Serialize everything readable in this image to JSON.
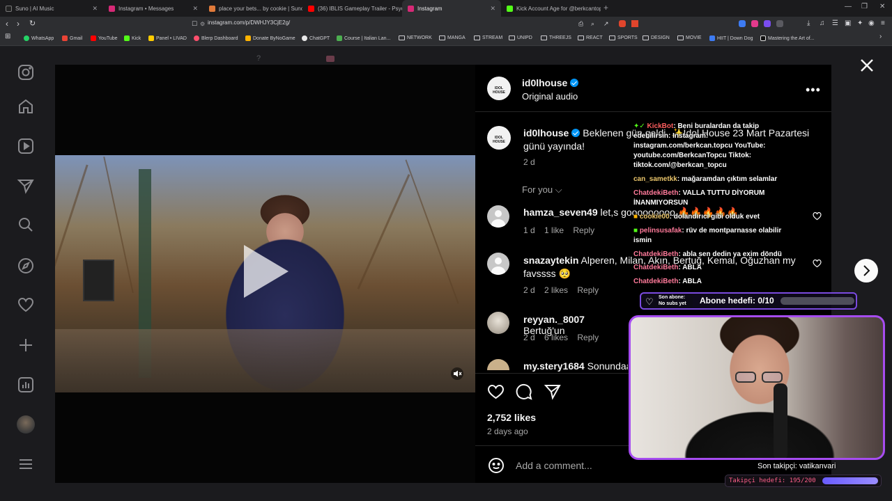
{
  "browser": {
    "tabs": [
      {
        "label": "Suno | AI Music",
        "active": false
      },
      {
        "label": "Instagram • Messages",
        "active": false
      },
      {
        "label": "place your bets... by cookie | Suno",
        "active": false
      },
      {
        "label": "(36) IBLIS Gameplay Trailer - Psychol...",
        "active": false
      },
      {
        "label": "Instagram",
        "active": true
      },
      {
        "label": "Kick Account Age for @berkcantop...",
        "active": false
      }
    ],
    "url": "instagram.com/p/DWHJY3CjE2g/",
    "bookmarks": [
      "WhatsApp",
      "Gmail",
      "YouTube",
      "Kick",
      "Panel • LIVAD",
      "Blerp Dashboard",
      "Donate ByNoGame",
      "ChatGPT",
      "Course | Italian Lan...",
      "NETWORK",
      "MANGA",
      "STREAM",
      "UNIPD",
      "THREEJS",
      "REACT",
      "SPORTS",
      "DESIGN",
      "MOVIE",
      "HIIT | Down Dog",
      "Mastering the Art of..."
    ]
  },
  "post": {
    "author": "id0lhouse",
    "audio": "Original audio",
    "caption_author": "id0lhouse",
    "caption_text": "Beklenen gün geldi. ✨İdol House 23 Mart Pazartesi günü yayında!",
    "caption_age": "2 d",
    "sort_label": "For you",
    "likes": "2,752 likes",
    "posted": "2 days ago",
    "add_comment_placeholder": "Add a comment..."
  },
  "comments": [
    {
      "user": "hamza_seven49",
      "text": "let,s gooooooooo 🔥🔥🔥🔥🔥",
      "age": "1 d",
      "likes": "1 like",
      "reply": "Reply"
    },
    {
      "user": "snazaytekin",
      "text": "Alperen, Milan, Akın, Bertuğ, Kemal, Oğuzhan my favssss 🥺",
      "age": "2 d",
      "likes": "2 likes",
      "reply": "Reply"
    },
    {
      "user": "reyyan._8007",
      "text": "Bertuğ'un",
      "age": "2 d",
      "likes": "6 likes",
      "reply": "Reply"
    },
    {
      "user": "my.stery1684",
      "text": "Sonundaa"
    }
  ],
  "stream_chat": [
    {
      "user": "KickBot",
      "text": "Beni buralardan da takip edebilirsin: Instagram: instagram.com/berkcan.topcu YouTube: youtube.com/BerkcanTopcu Tiktok: tiktok.com/@berkcan_topcu"
    },
    {
      "user": "can_sametkk",
      "text": "mağaramdan çıktım selamlar"
    },
    {
      "user": "ChatdekiBeth",
      "text": "VALLA TUTTU DİYORUM İNANMIYORSUN"
    },
    {
      "user": "cookie00",
      "text": "dolandırıcı gibi olduk evet"
    },
    {
      "user": "pelinsusafak",
      "text": "rüv de montparnasse olabilir ismin"
    },
    {
      "user": "ChatdekiBeth",
      "text": "abla sen dedin ya exim döndü"
    },
    {
      "user": "ChatdekiBeth",
      "text": "ABLA"
    },
    {
      "user": "ChatdekiBeth",
      "text": "ABLA"
    }
  ],
  "stream": {
    "last_sub_label": "Son abone:",
    "last_sub_value": "No subs yet",
    "sub_goal": "Abone hedefi: 0/10",
    "sub_goal_fraction": 0.0,
    "last_follower": "Son takipçi: vatikanvari",
    "follower_goal": "Takipçi hedefi: 195/200",
    "follower_goal_fraction": 0.975
  },
  "colors": {
    "accent": "#0095f6",
    "overlay_border": "#a64cf0"
  }
}
